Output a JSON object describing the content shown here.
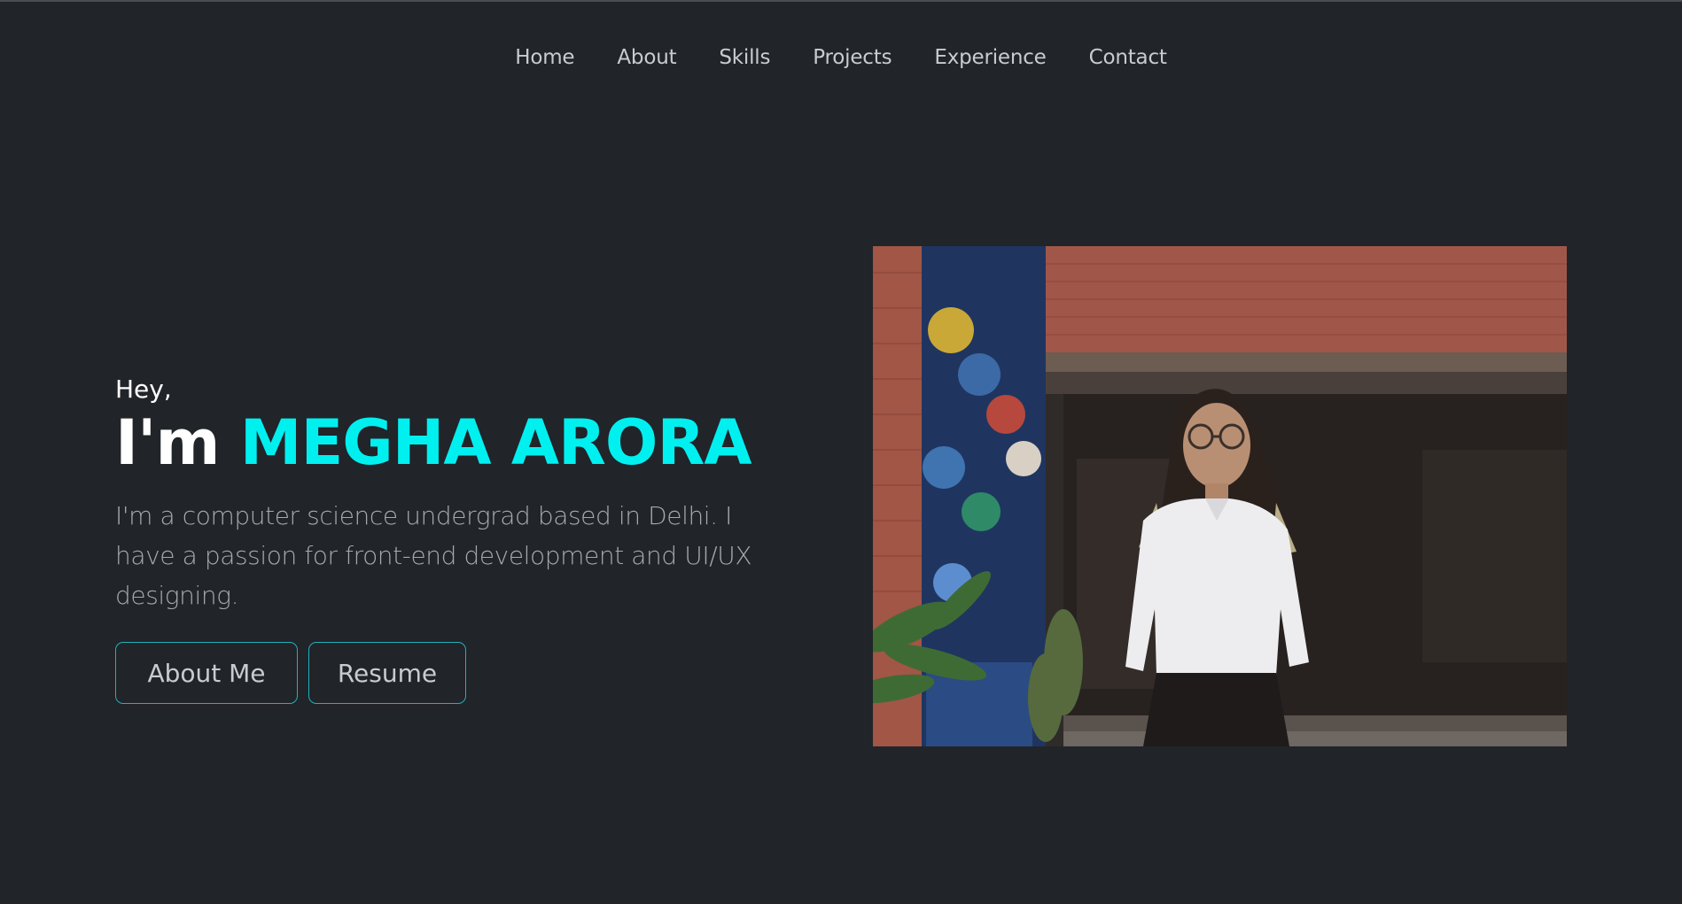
{
  "nav": {
    "items": [
      {
        "label": "Home"
      },
      {
        "label": "About"
      },
      {
        "label": "Skills"
      },
      {
        "label": "Projects"
      },
      {
        "label": "Experience"
      },
      {
        "label": "Contact"
      }
    ]
  },
  "hero": {
    "greeting": "Hey,",
    "intro": "I'm ",
    "name": "MEGHA ARORA",
    "bio": "I'm a computer science undergrad based in Delhi. I have a passion for front-end development and UI/UX designing.",
    "buttons": {
      "about_label": "About Me",
      "resume_label": "Resume"
    }
  },
  "colors": {
    "background": "#212429",
    "accent": "#00f0f0",
    "button_border": "#20b2b8",
    "nav_text": "#c9cbcf",
    "body_text": "#a6a9ae"
  }
}
